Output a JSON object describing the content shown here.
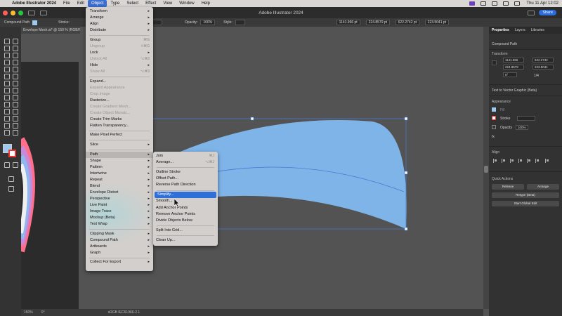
{
  "menubar": {
    "apple": "",
    "app_name": "Adobe Illustrator 2024",
    "menus": [
      "File",
      "Edit",
      "Object",
      "Type",
      "Select",
      "Effect",
      "View",
      "Window",
      "Help"
    ],
    "clock": "Thu 11 Apr  12:02"
  },
  "titlebar": {
    "title": "Adobe Illustrator 2024",
    "share": "Share"
  },
  "controlbar": {
    "selection": "Compound Path",
    "stroke_label": "Stroke:",
    "opacity_label": "Opacity:",
    "opacity": "100%",
    "style_label": "Style:",
    "x": "1141.966 pt",
    "y": "224.8579 pt",
    "w": "622.2742 pt",
    "h": "223.5041 pt",
    "fill_color": "#9ec9f0"
  },
  "document": {
    "tab": "Envelope Mesh.ai* @ 150 % (RGB/Preview)"
  },
  "statusbar": {
    "zoom": "150%",
    "rotation": "0°",
    "info": "sRGB IEC61966-2.1"
  },
  "object_menu": {
    "items": [
      {
        "label": "Transform",
        "submenu": true
      },
      {
        "label": "Arrange",
        "submenu": true
      },
      {
        "label": "Align",
        "submenu": true
      },
      {
        "label": "Distribute",
        "submenu": true
      },
      {
        "sep": true
      },
      {
        "label": "Group",
        "shortcut": "⌘G"
      },
      {
        "label": "Ungroup",
        "shortcut": "⇧⌘G",
        "disabled": true
      },
      {
        "label": "Lock",
        "submenu": true
      },
      {
        "label": "Unlock All",
        "shortcut": "⌥⌘2",
        "disabled": true
      },
      {
        "label": "Hide",
        "submenu": true
      },
      {
        "label": "Show All",
        "shortcut": "⌥⌘3",
        "disabled": true
      },
      {
        "sep": true
      },
      {
        "label": "Expand..."
      },
      {
        "label": "Expand Appearance",
        "disabled": true
      },
      {
        "label": "Crop Image",
        "disabled": true
      },
      {
        "label": "Rasterize..."
      },
      {
        "label": "Create Gradient Mesh...",
        "disabled": true
      },
      {
        "label": "Create Object Mosaic...",
        "disabled": true
      },
      {
        "label": "Create Trim Marks"
      },
      {
        "label": "Flatten Transparency..."
      },
      {
        "sep": true
      },
      {
        "label": "Make Pixel Perfect"
      },
      {
        "sep": true
      },
      {
        "label": "Slice",
        "submenu": true
      },
      {
        "sep": true
      },
      {
        "label": "Path",
        "submenu": true,
        "highlighted": true
      },
      {
        "label": "Shape",
        "submenu": true
      },
      {
        "label": "Pattern",
        "submenu": true
      },
      {
        "label": "Intertwine",
        "submenu": true
      },
      {
        "label": "Repeat",
        "submenu": true
      },
      {
        "label": "Blend",
        "submenu": true
      },
      {
        "label": "Envelope Distort",
        "submenu": true
      },
      {
        "label": "Perspective",
        "submenu": true
      },
      {
        "label": "Live Paint",
        "submenu": true
      },
      {
        "label": "Image Trace",
        "submenu": true
      },
      {
        "label": "Mockup (Beta)",
        "submenu": true
      },
      {
        "label": "Text Wrap",
        "submenu": true
      },
      {
        "sep": true
      },
      {
        "label": "Clipping Mask",
        "submenu": true
      },
      {
        "label": "Compound Path",
        "submenu": true
      },
      {
        "label": "Artboards",
        "submenu": true
      },
      {
        "label": "Graph",
        "submenu": true
      },
      {
        "sep": true
      },
      {
        "label": "Collect For Export",
        "submenu": true
      }
    ]
  },
  "path_submenu": {
    "items": [
      {
        "label": "Join",
        "shortcut": "⌘J"
      },
      {
        "label": "Average...",
        "shortcut": "⌥⌘J"
      },
      {
        "sep": true
      },
      {
        "label": "Outline Stroke"
      },
      {
        "label": "Offset Path..."
      },
      {
        "label": "Reverse Path Direction"
      },
      {
        "sep": true
      },
      {
        "label": "Simplify...",
        "selected": true
      },
      {
        "label": "Smooth..."
      },
      {
        "label": "Add Anchor Points"
      },
      {
        "label": "Remove Anchor Points"
      },
      {
        "label": "Divide Objects Below"
      },
      {
        "sep": true
      },
      {
        "label": "Split Into Grid..."
      },
      {
        "sep": true
      },
      {
        "label": "Clean Up..."
      }
    ]
  },
  "right_panel": {
    "tabs": [
      "Properties",
      "Layers",
      "Libraries"
    ],
    "selection": "Compound Path",
    "transform": {
      "heading": "Transform",
      "x": "1141.966",
      "y": "224.8579",
      "w": "622.2742",
      "h": "223.5041",
      "angle": "0°",
      "ratio": "1/4"
    },
    "text_to_vector": "Text to Vector Graphic (Beta)",
    "appearance": {
      "heading": "Appearance",
      "fill": "Fill",
      "stroke": "Stroke",
      "opacity": "Opacity",
      "opacity_value": "100%",
      "fx": "fx"
    },
    "align_heading": "Align",
    "quick_actions": {
      "heading": "Quick Actions",
      "release": "Release",
      "arrange": "Arrange",
      "retype": "Retype (Beta)",
      "global_edit": "Start Global Edit"
    }
  },
  "artwork": {
    "shape_color": "#7fb4e8",
    "selection_color": "#4a7bd4"
  }
}
